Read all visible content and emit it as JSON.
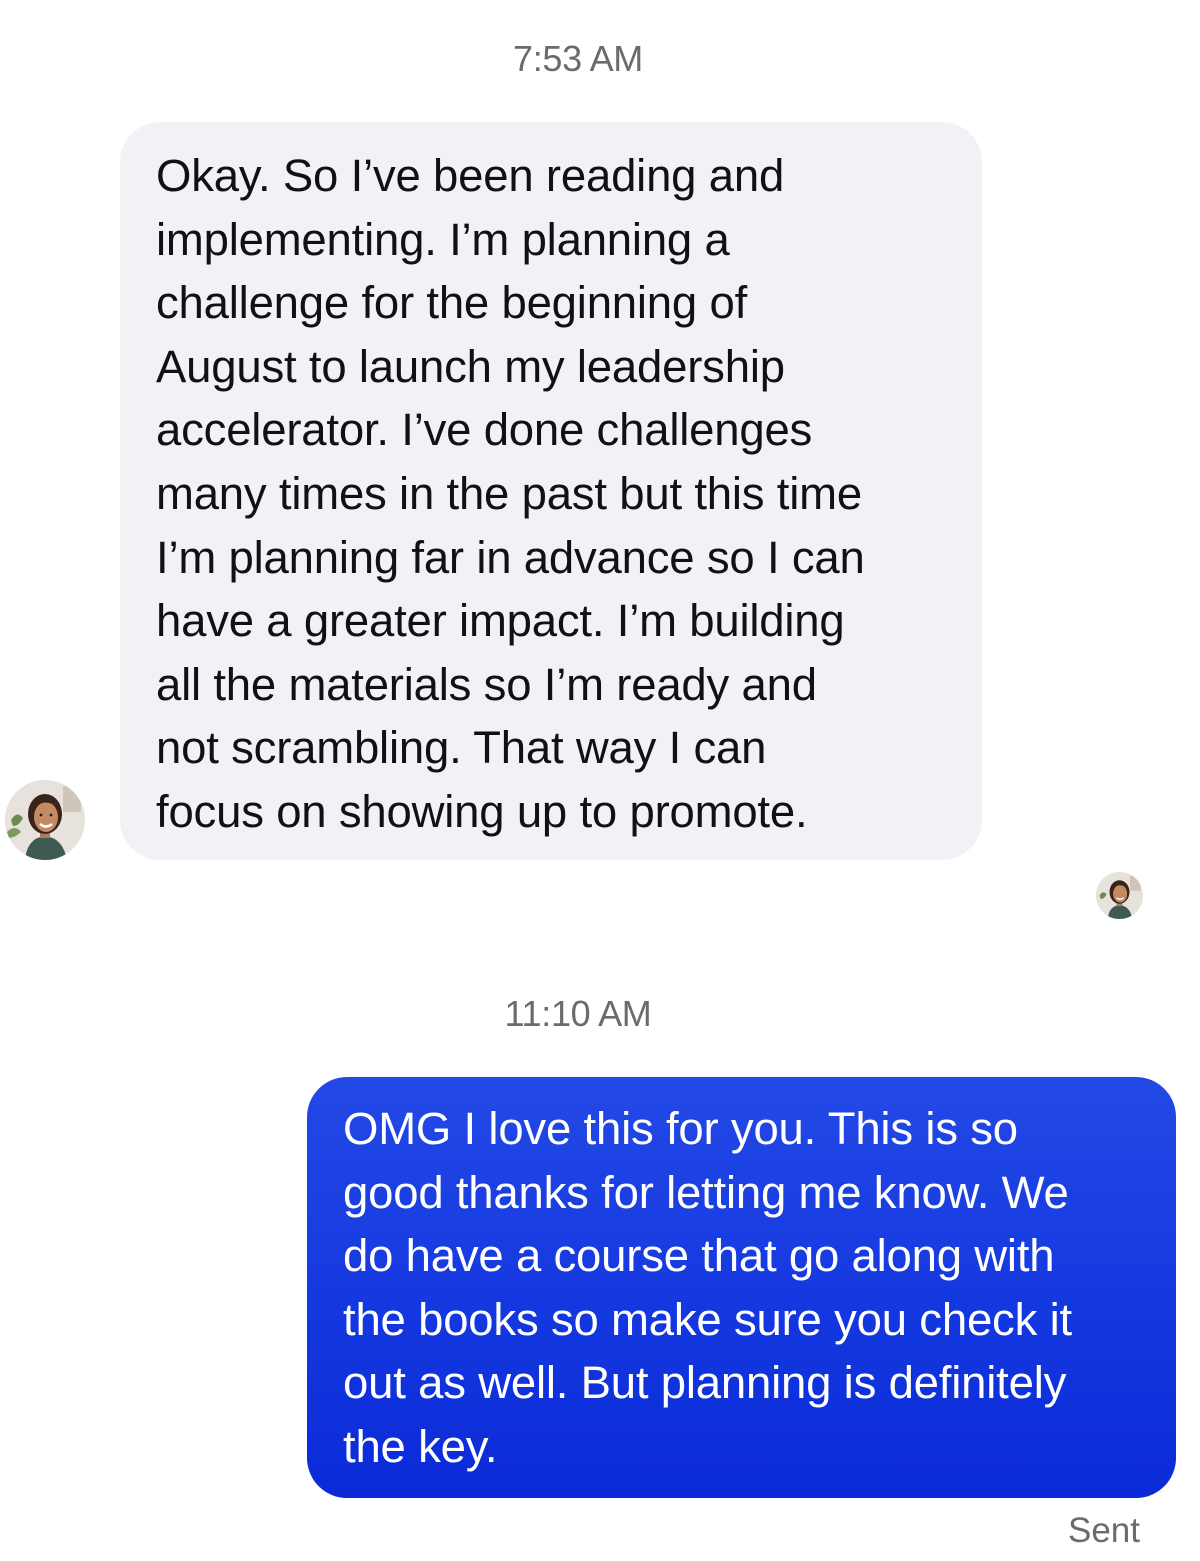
{
  "thread": {
    "messages": [
      {
        "timestamp": "7:53 AM",
        "direction": "incoming",
        "lines": [
          "Okay. So I’ve been reading and",
          "implementing. I’m planning a",
          "challenge for the beginning of",
          "August to launch my leadership",
          "accelerator. I’ve done challenges",
          "many times in the past but this time",
          "I’m planning far in advance so I can",
          "have a greater impact. I’m building",
          "all the materials so I’m ready and",
          "not scrambling. That way I can",
          "focus on showing up to promote."
        ]
      },
      {
        "timestamp": "11:10 AM",
        "direction": "outgoing",
        "lines": [
          "OMG I love this for you. This is so",
          "good thanks for letting me know. We",
          "do have a course that go along with",
          "the books so make sure you check it",
          "out as well. But planning is definitely",
          "the key."
        ],
        "status": "Sent"
      }
    ],
    "contact_avatar_icon": "contact-avatar",
    "read_receipt_icon": "read-receipt-avatar"
  },
  "colors": {
    "incoming_bubble": "#f1f2f6",
    "outgoing_bubble": "#1438df",
    "timestamp_text": "#6b6b6f"
  }
}
